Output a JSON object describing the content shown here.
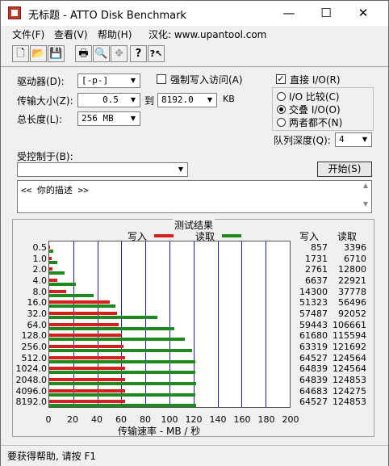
{
  "window": {
    "title": "无标题 - ATTO Disk Benchmark",
    "controls": {
      "minimize": "—",
      "maximize": "☐",
      "close": "✕"
    }
  },
  "menu": {
    "file": "文件(F)",
    "view": "查看(V)",
    "help": "帮助(H)",
    "localized": "汉化: www.upantool.com"
  },
  "toolbar": {
    "new": "🗋",
    "open": "📂",
    "save": "💾",
    "print": "🖶",
    "preview": "🔍",
    "move": "✥",
    "help": "?",
    "context_help": "?↖"
  },
  "settings": {
    "drive_label": "驱动器(D):",
    "drive_value": "[-p-]",
    "transfer_label": "传输大小(Z):",
    "transfer_from": "0.5",
    "to_label": "到",
    "transfer_to": "8192.0",
    "kb_unit": "KB",
    "total_length_label": "总长度(L):",
    "total_length_value": "256 MB",
    "force_write_label": "强制写入访问(A)",
    "direct_io_label": "直接 I/O(R)",
    "io_compare_label": "I/O 比较(C)",
    "overlap_io_label": "交叠 I/O(O)",
    "neither_label": "两者都不(N)",
    "queue_depth_label": "队列深度(Q):",
    "queue_depth_value": "4",
    "controlled_by_label": "受控制于(B):",
    "controlled_by_value": "",
    "start_button": "开始(S)",
    "description": "<<    你的描述    >>"
  },
  "results": {
    "title": "测试结果",
    "write_label": "写入",
    "read_label": "读取",
    "col_write": "写入",
    "col_read": "读取",
    "x_axis_label": "传输速率 - MB / 秒",
    "colors": {
      "write": "#d42020",
      "read": "#1e8a1e",
      "grid": "#1a1ad0"
    }
  },
  "chart_data": {
    "type": "bar",
    "orientation": "horizontal",
    "title": "测试结果",
    "xlabel": "传输速率 - MB / 秒",
    "xlim": [
      0,
      200
    ],
    "x_ticks": [
      "0",
      "20",
      "40",
      "60",
      "80",
      "100",
      "120",
      "140",
      "160",
      "180",
      "200"
    ],
    "categories": [
      "0.5",
      "1.0",
      "2.0",
      "4.0",
      "8.0",
      "16.0",
      "32.0",
      "64.0",
      "128.0",
      "256.0",
      "512.0",
      "1024.0",
      "2048.0",
      "4096.0",
      "8192.0"
    ],
    "series": [
      {
        "name": "写入",
        "values_kb": [
          "857",
          "1731",
          "2761",
          "6637",
          "14300",
          "51323",
          "57487",
          "59443",
          "61680",
          "63319",
          "64527",
          "64839",
          "64839",
          "64683",
          "64527"
        ]
      },
      {
        "name": "读取",
        "values_kb": [
          "3396",
          "6710",
          "12800",
          "22921",
          "37778",
          "56496",
          "92052",
          "106661",
          "115594",
          "121692",
          "124564",
          "124564",
          "124853",
          "124275",
          "124853"
        ]
      }
    ]
  },
  "status": {
    "text": "要获得帮助, 请按 F1"
  }
}
